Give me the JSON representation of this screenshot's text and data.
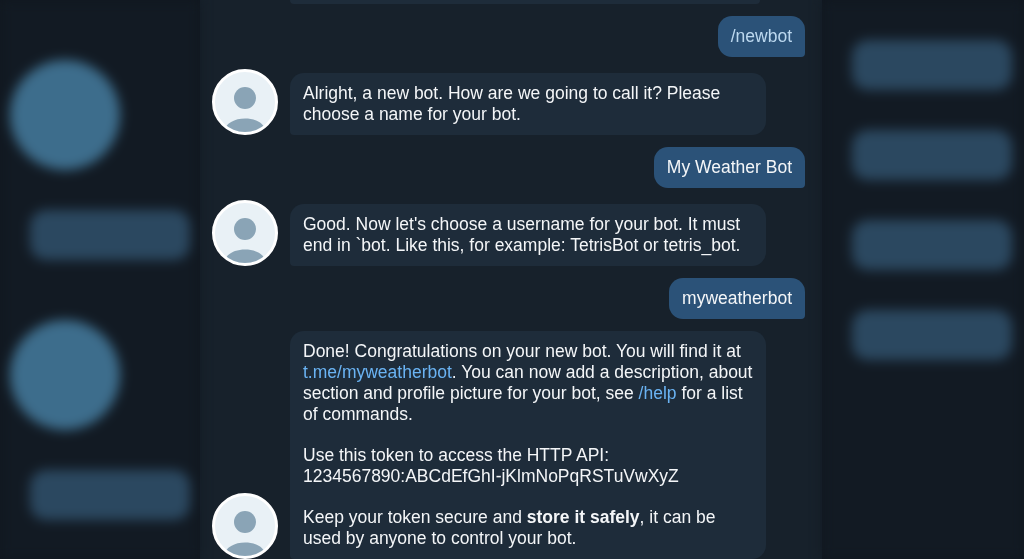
{
  "messages": [
    {
      "kind": "outgoing",
      "command": true,
      "paragraphs": [
        [
          {
            "kind": "text",
            "text": "/newbot"
          }
        ]
      ]
    },
    {
      "kind": "incoming",
      "command": false,
      "paragraphs": [
        [
          {
            "kind": "text",
            "text": "Alright, a new bot. How are we going to call it? Please choose a name for your bot."
          }
        ]
      ]
    },
    {
      "kind": "outgoing",
      "command": false,
      "paragraphs": [
        [
          {
            "kind": "text",
            "text": "My Weather Bot"
          }
        ]
      ]
    },
    {
      "kind": "incoming",
      "command": false,
      "paragraphs": [
        [
          {
            "kind": "text",
            "text": "Good. Now let's choose a username for your bot. It must end in `bot. Like this, for example: TetrisBot or tetris_bot."
          }
        ]
      ]
    },
    {
      "kind": "outgoing",
      "command": false,
      "paragraphs": [
        [
          {
            "kind": "text",
            "text": "myweatherbot"
          }
        ]
      ]
    },
    {
      "kind": "incoming",
      "command": false,
      "paragraphs": [
        [
          {
            "kind": "text",
            "text": "Done! Congratulations on your new bot. You will find it at "
          },
          {
            "kind": "link",
            "text": "t.me/myweatherbot"
          },
          {
            "kind": "text",
            "text": ". You can now add a description, about section and profile picture for your bot, see "
          },
          {
            "kind": "link",
            "text": "/help"
          },
          {
            "kind": "text",
            "text": " for a list of commands."
          }
        ],
        [
          {
            "kind": "text",
            "text": "Use this token to access the HTTP API:"
          },
          {
            "kind": "break"
          },
          {
            "kind": "text",
            "text": "1234567890:ABCdEfGhI-jKlmNoPqRSTuVwXyZ"
          }
        ],
        [
          {
            "kind": "text",
            "text": "Keep your token secure and **store it safely**, it can be used by anyone to control your bot."
          }
        ]
      ]
    }
  ]
}
